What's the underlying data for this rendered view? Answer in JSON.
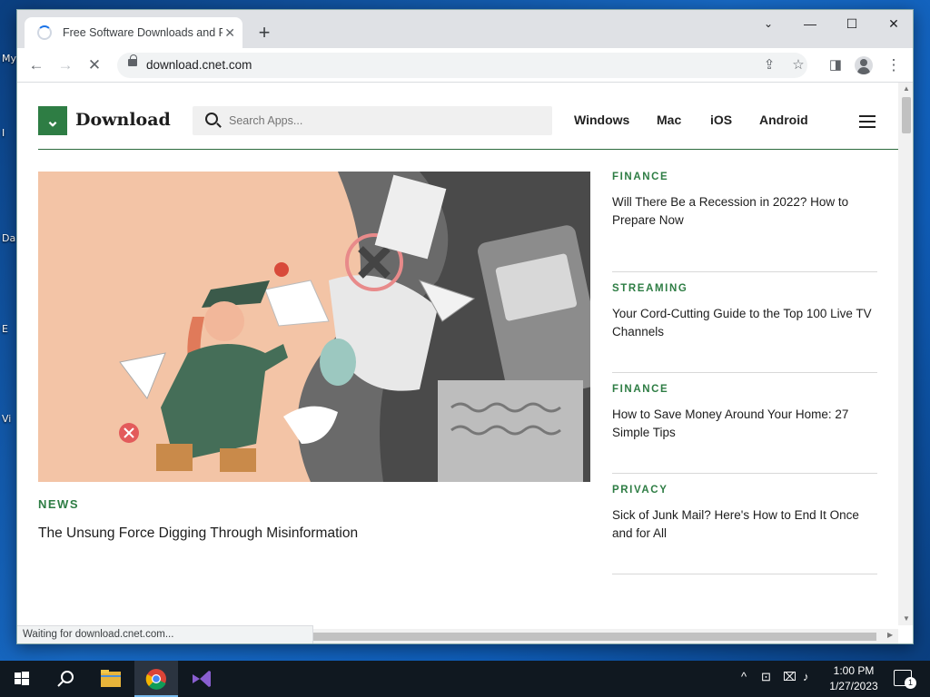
{
  "desktop": {
    "icon_labels": [
      "My",
      "I",
      "Da",
      "E",
      "Vi"
    ]
  },
  "browser": {
    "tab_title": "Free Software Downloads and Reviews",
    "url": "download.cnet.com",
    "status": "Waiting for download.cnet.com..."
  },
  "site": {
    "logo_text": "Download",
    "search_placeholder": "Search Apps...",
    "nav": [
      "Windows",
      "Mac",
      "iOS",
      "Android"
    ],
    "hero": {
      "category": "NEWS",
      "title": "The Unsung Force Digging Through Misinformation"
    },
    "articles": [
      {
        "category": "FINANCE",
        "title": "Will There Be a Recession in 2022? How to Prepare Now"
      },
      {
        "category": "STREAMING",
        "title": "Your Cord-Cutting Guide to the Top 100 Live TV Channels"
      },
      {
        "category": "FINANCE",
        "title": "How to Save Money Around Your Home: 27 Simple Tips"
      },
      {
        "category": "PRIVACY",
        "title": "Sick of Junk Mail? Here's How to End It Once and for All"
      }
    ],
    "colors": {
      "brand_green": "#2e7d44"
    }
  },
  "taskbar": {
    "time": "1:00 PM",
    "date": "1/27/2023",
    "notification_count": "1"
  },
  "icons": [
    "tab-loading-spinner-icon",
    "close-icon",
    "plus-icon",
    "chevron-down-icon",
    "minimize-icon",
    "maximize-icon",
    "back-arrow-icon",
    "forward-arrow-icon",
    "stop-loading-icon",
    "lock-icon",
    "share-icon",
    "star-icon",
    "side-panel-icon",
    "profile-icon",
    "more-vert-icon",
    "search-icon",
    "hamburger-menu-icon",
    "windows-start-icon",
    "taskbar-search-icon",
    "file-explorer-icon",
    "chrome-icon",
    "visual-studio-icon"
  ]
}
